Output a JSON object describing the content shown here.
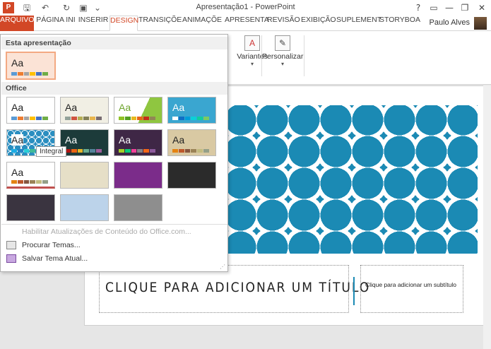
{
  "window": {
    "app_icon": "P",
    "title": "Apresentação1 - PowerPoint",
    "help": "?",
    "min": "—",
    "max": "❐",
    "close": "✕"
  },
  "tabs": [
    "ARQUIVO",
    "PÁGINA INI",
    "INSERIR",
    "DESIGN",
    "TRANSIÇÕE",
    "ANIMAÇÕE",
    "APRESENTA",
    "REVISÃO",
    "EXIBIÇÃO",
    "SUPLEMENT",
    "STORYBOA"
  ],
  "user": "Paulo Alves",
  "ribbon": {
    "variants": "Variantes",
    "customize": "Personalizar"
  },
  "gallery": {
    "section_this": "Esta apresentação",
    "section_office": "Office",
    "tooltip": "Integral",
    "aa": "Aa",
    "enable_updates": "Habilitar Atualizações de Conteúdo do Office.com...",
    "browse": "Procurar Temas...",
    "save": "Salvar Tema Atual..."
  },
  "slide": {
    "title": "CLIQUE PARA ADICIONAR UM TÍTULO",
    "subtitle": "Clique para adicionar um subtítulo"
  },
  "colors": {
    "accent": "#d24726",
    "theme_blue": "#1b8ab4"
  }
}
